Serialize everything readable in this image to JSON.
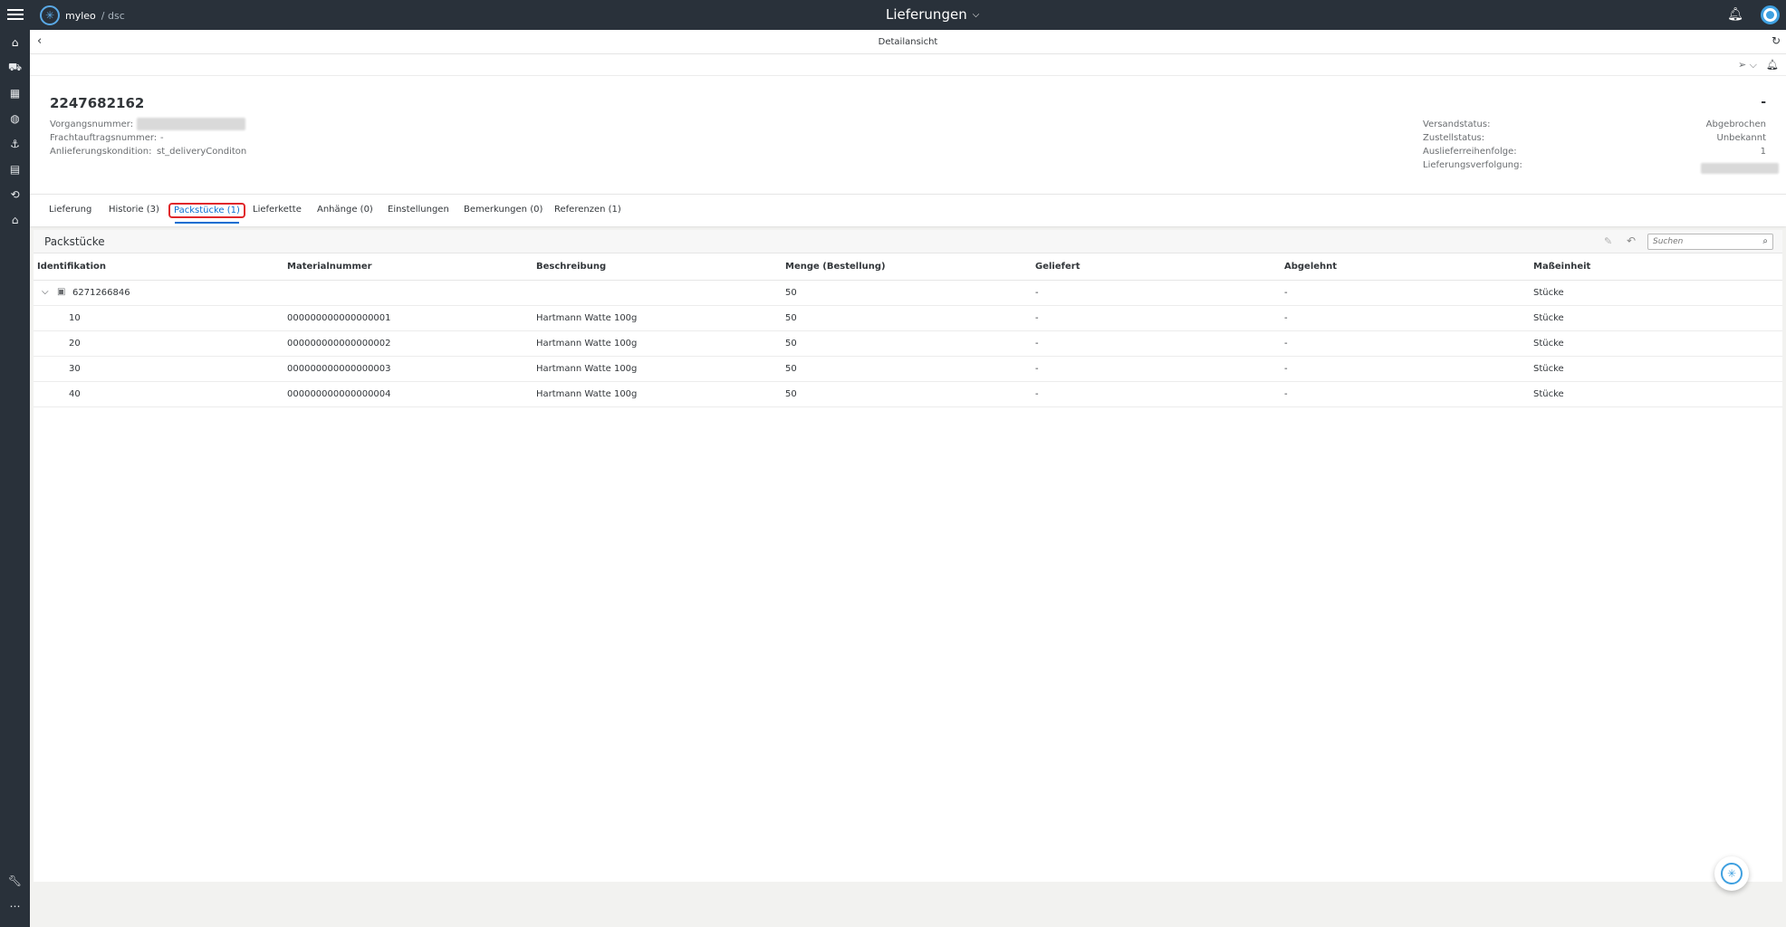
{
  "app": {
    "brand_name": "myleo",
    "brand_sub": "/ dsc",
    "title": "Lieferungen",
    "logo_icon": "snowflake-icon"
  },
  "subheader": {
    "title": "Detailansicht"
  },
  "object": {
    "title": "2247682162",
    "right_dash": "-",
    "left_fields": [
      {
        "label": "Vorgangsnummer:",
        "value": ""
      },
      {
        "label": "Frachtauftragsnummer:",
        "value": "-"
      },
      {
        "label": "Anlieferungskondition:",
        "value": "st_deliveryConditon"
      }
    ],
    "right_fields": [
      {
        "label": "Versandstatus:",
        "value": "Abgebrochen"
      },
      {
        "label": "Zustellstatus:",
        "value": "Unbekannt"
      },
      {
        "label": "Auslieferreihenfolge:",
        "value": "1"
      },
      {
        "label": "Lieferungsverfolgung:",
        "value": ""
      }
    ]
  },
  "tabs": [
    {
      "label": "Lieferung"
    },
    {
      "label": "Historie (3)"
    },
    {
      "label": "Packstücke (1)"
    },
    {
      "label": "Lieferkette"
    },
    {
      "label": "Anhänge (0)"
    },
    {
      "label": "Einstellungen"
    },
    {
      "label": "Bemerkungen (0)"
    },
    {
      "label": "Referenzen (1)"
    }
  ],
  "active_tab": "Packstücke (1)",
  "section": {
    "title": "Packstücke",
    "search_placeholder": "Suchen"
  },
  "table": {
    "columns": [
      "Identifikation",
      "Materialnummer",
      "Beschreibung",
      "Menge (Bestellung)",
      "Geliefert",
      "Abgelehnt",
      "Maßeinheit"
    ],
    "group": {
      "id": "6271266846",
      "menge": "50",
      "geliefert": "-",
      "abgelehnt": "-",
      "einheit": "Stücke"
    },
    "rows": [
      {
        "id": "10",
        "material": "000000000000000001",
        "beschreibung": "Hartmann Watte 100g",
        "menge": "50",
        "geliefert": "-",
        "abgelehnt": "-",
        "einheit": "Stücke"
      },
      {
        "id": "20",
        "material": "000000000000000002",
        "beschreibung": "Hartmann Watte 100g",
        "menge": "50",
        "geliefert": "-",
        "abgelehnt": "-",
        "einheit": "Stücke"
      },
      {
        "id": "30",
        "material": "000000000000000003",
        "beschreibung": "Hartmann Watte 100g",
        "menge": "50",
        "geliefert": "-",
        "abgelehnt": "-",
        "einheit": "Stücke"
      },
      {
        "id": "40",
        "material": "000000000000000004",
        "beschreibung": "Hartmann Watte 100g",
        "menge": "50",
        "geliefert": "-",
        "abgelehnt": "-",
        "einheit": "Stücke"
      }
    ]
  },
  "rail_icons": [
    "home-icon",
    "truck-off-icon",
    "dashboard-icon",
    "globe-icon",
    "anchor-icon",
    "calendar-icon",
    "document-sync-icon",
    "warehouse-icon",
    "wrench-icon",
    "more-icon"
  ],
  "colors": {
    "shell": "#29313a",
    "accent": "#0a6ed1",
    "highlight": "#e0272b"
  }
}
